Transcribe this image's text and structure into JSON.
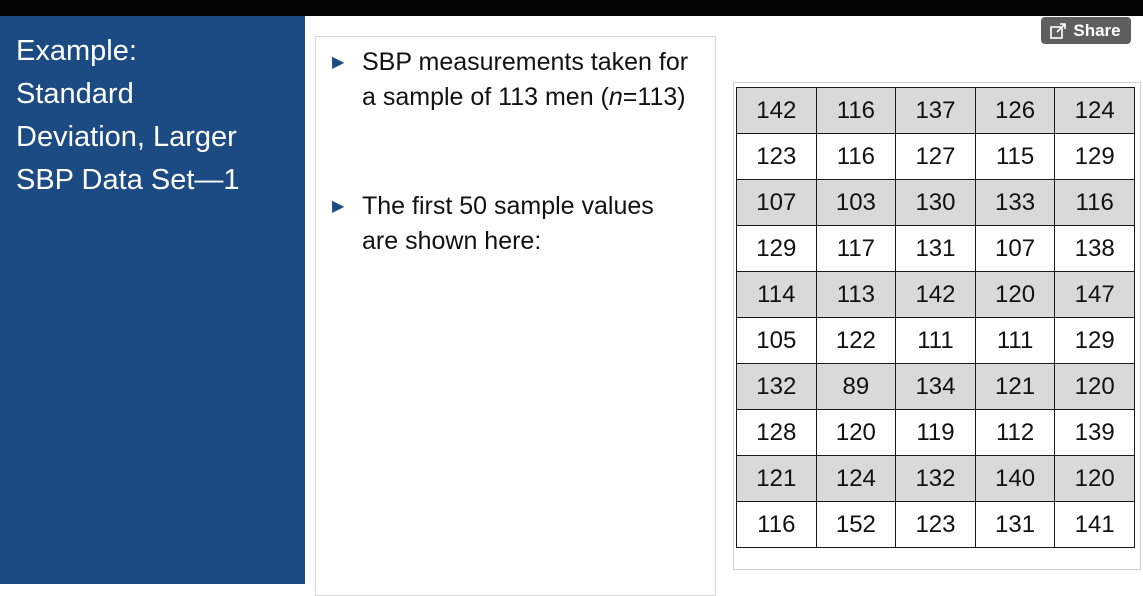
{
  "sidebar": {
    "title": "Example:\nStandard\nDeviation, Larger\nSBP Data Set—1"
  },
  "share": {
    "label": "Share",
    "icon": "share-icon"
  },
  "bullets": [
    {
      "icon": "triangle-bullet-icon",
      "parts": [
        "SBP measurements taken for a sample of 113 men (",
        "n",
        "=113)"
      ]
    },
    {
      "icon": "triangle-bullet-icon",
      "text": "The first 50 sample values are shown here:"
    }
  ],
  "table": {
    "rows": [
      [
        142,
        116,
        137,
        126,
        124
      ],
      [
        123,
        116,
        127,
        115,
        129
      ],
      [
        107,
        103,
        130,
        133,
        116
      ],
      [
        129,
        117,
        131,
        107,
        138
      ],
      [
        114,
        113,
        142,
        120,
        147
      ],
      [
        105,
        122,
        111,
        111,
        129
      ],
      [
        132,
        89,
        134,
        121,
        120
      ],
      [
        128,
        120,
        119,
        112,
        139
      ],
      [
        121,
        124,
        132,
        140,
        120
      ],
      [
        116,
        152,
        123,
        131,
        141
      ]
    ]
  },
  "colors": {
    "sidebar": "#1c4a82",
    "shaded_row": "#d9d9d9",
    "share_button": "#5f5f5f"
  }
}
